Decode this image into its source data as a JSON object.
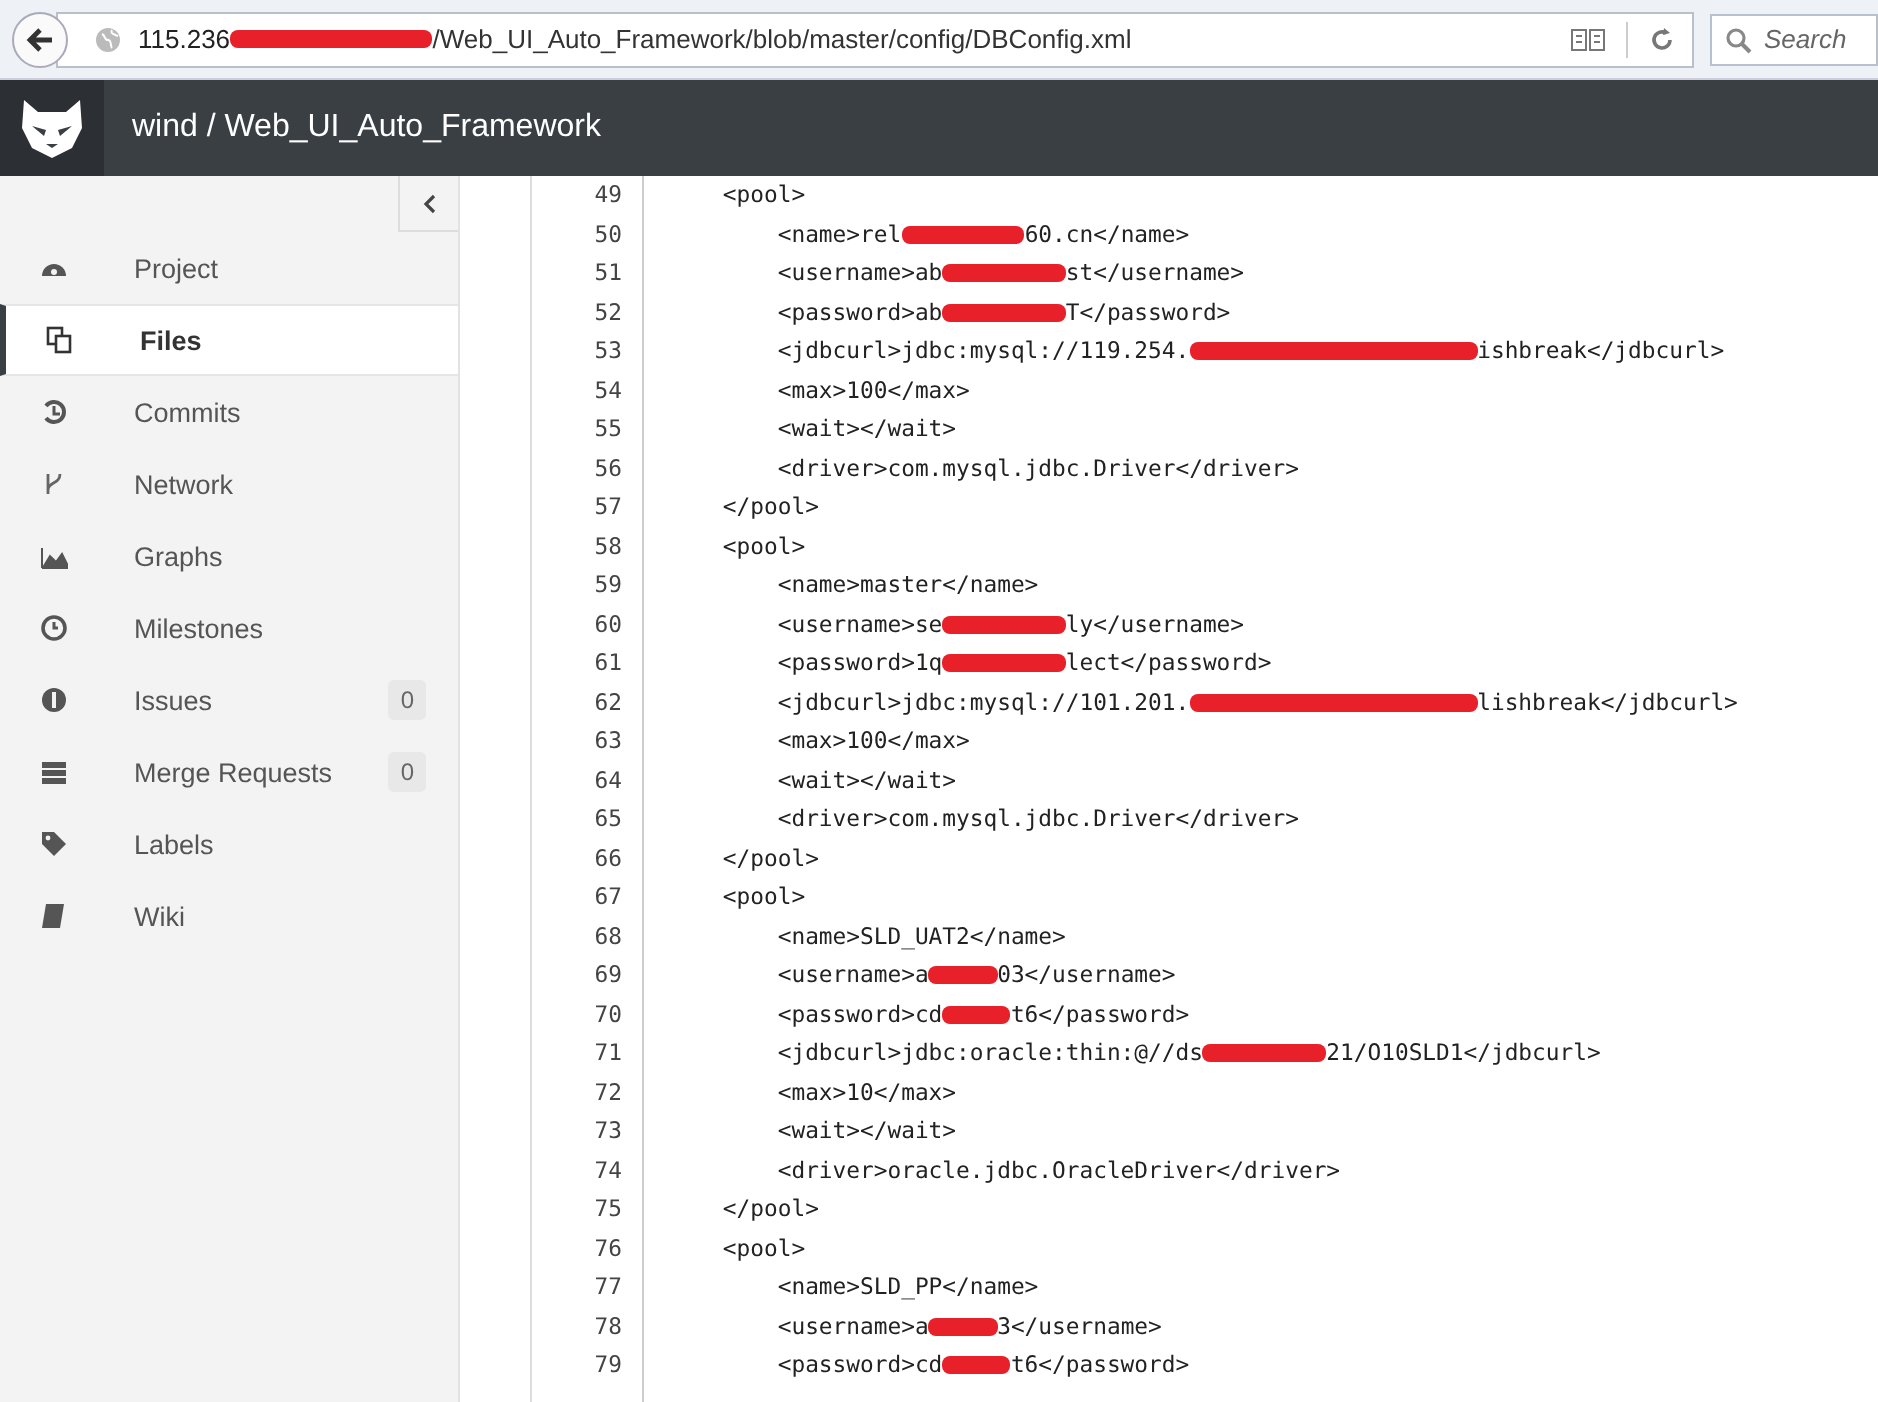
{
  "browser": {
    "url_parts": [
      {
        "kind": "text",
        "text": "115.236"
      },
      {
        "kind": "redaction"
      },
      {
        "kind": "text",
        "text": "/Web_UI_Auto_Framework/blob/master/config/DBConfig.xml"
      }
    ],
    "search": {
      "placeholder": "Search"
    }
  },
  "header": {
    "title": "wind / Web_UI_Auto_Framework"
  },
  "sidebar": {
    "items": [
      {
        "label": "Project",
        "selected": false
      },
      {
        "label": "Files",
        "selected": true
      },
      {
        "label": "Commits",
        "selected": false
      },
      {
        "label": "Network",
        "selected": false
      },
      {
        "label": "Graphs",
        "selected": false
      },
      {
        "label": "Milestones",
        "selected": false
      },
      {
        "label": "Issues",
        "selected": false,
        "count": "0"
      },
      {
        "label": "Merge Requests",
        "selected": false,
        "count": "0"
      },
      {
        "label": "Labels",
        "selected": false
      },
      {
        "label": "Wiki",
        "selected": false
      }
    ]
  },
  "file": {
    "lines": [
      {
        "number": "49",
        "parts": [
          {
            "kind": "text",
            "text": "    <pool>"
          }
        ]
      },
      {
        "number": "50",
        "parts": [
          {
            "kind": "text",
            "text": "        <name>rel"
          },
          {
            "kind": "redaction"
          },
          {
            "kind": "text",
            "text": "60.cn</name>"
          }
        ]
      },
      {
        "number": "51",
        "parts": [
          {
            "kind": "text",
            "text": "        <username>ab"
          },
          {
            "kind": "redaction"
          },
          {
            "kind": "text",
            "text": "st</username>"
          }
        ]
      },
      {
        "number": "52",
        "parts": [
          {
            "kind": "text",
            "text": "        <password>ab"
          },
          {
            "kind": "redaction"
          },
          {
            "kind": "text",
            "text": "T</password>"
          }
        ]
      },
      {
        "number": "53",
        "parts": [
          {
            "kind": "text",
            "text": "        <jdbcurl>jdbc:mysql://119.254."
          },
          {
            "kind": "long_redaction"
          },
          {
            "kind": "text",
            "text": "ishbreak</jdbcurl>"
          }
        ]
      },
      {
        "number": "54",
        "parts": [
          {
            "kind": "text",
            "text": "        <max>100</max>"
          }
        ]
      },
      {
        "number": "55",
        "parts": [
          {
            "kind": "text",
            "text": "        <wait></wait>"
          }
        ]
      },
      {
        "number": "56",
        "parts": [
          {
            "kind": "text",
            "text": "        <driver>com.mysql.jdbc.Driver</driver>"
          }
        ]
      },
      {
        "number": "57",
        "parts": [
          {
            "kind": "text",
            "text": "    </pool>"
          }
        ]
      },
      {
        "number": "58",
        "parts": [
          {
            "kind": "text",
            "text": "    <pool>"
          }
        ]
      },
      {
        "number": "59",
        "parts": [
          {
            "kind": "text",
            "text": "        <name>master</name>"
          }
        ]
      },
      {
        "number": "60",
        "parts": [
          {
            "kind": "text",
            "text": "        <username>se"
          },
          {
            "kind": "redaction"
          },
          {
            "kind": "text",
            "text": "ly</username>"
          }
        ]
      },
      {
        "number": "61",
        "parts": [
          {
            "kind": "text",
            "text": "        <password>1q"
          },
          {
            "kind": "redaction"
          },
          {
            "kind": "text",
            "text": "lect</password>"
          }
        ]
      },
      {
        "number": "62",
        "parts": [
          {
            "kind": "text",
            "text": "        <jdbcurl>jdbc:mysql://101.201."
          },
          {
            "kind": "long_redaction"
          },
          {
            "kind": "text",
            "text": "lishbreak</jdbcurl>"
          }
        ]
      },
      {
        "number": "63",
        "parts": [
          {
            "kind": "text",
            "text": "        <max>100</max>"
          }
        ]
      },
      {
        "number": "64",
        "parts": [
          {
            "kind": "text",
            "text": "        <wait></wait>"
          }
        ]
      },
      {
        "number": "65",
        "parts": [
          {
            "kind": "text",
            "text": "        <driver>com.mysql.jdbc.Driver</driver>"
          }
        ]
      },
      {
        "number": "66",
        "parts": [
          {
            "kind": "text",
            "text": "    </pool>"
          }
        ]
      },
      {
        "number": "67",
        "parts": [
          {
            "kind": "text",
            "text": "    <pool>"
          }
        ]
      },
      {
        "number": "68",
        "parts": [
          {
            "kind": "text",
            "text": "        <name>SLD_UAT2</name>"
          }
        ]
      },
      {
        "number": "69",
        "parts": [
          {
            "kind": "text",
            "text": "        <username>a"
          },
          {
            "kind": "short_redaction"
          },
          {
            "kind": "text",
            "text": "03</username>"
          }
        ]
      },
      {
        "number": "70",
        "parts": [
          {
            "kind": "text",
            "text": "        <password>cd"
          },
          {
            "kind": "short_redaction"
          },
          {
            "kind": "text",
            "text": "t6</password>"
          }
        ]
      },
      {
        "number": "71",
        "parts": [
          {
            "kind": "text",
            "text": "        <jdbcurl>jdbc:oracle:thin:@//ds"
          },
          {
            "kind": "redaction"
          },
          {
            "kind": "text",
            "text": "21/O10SLD1</jdbcurl>"
          }
        ]
      },
      {
        "number": "72",
        "parts": [
          {
            "kind": "text",
            "text": "        <max>10</max>"
          }
        ]
      },
      {
        "number": "73",
        "parts": [
          {
            "kind": "text",
            "text": "        <wait></wait>"
          }
        ]
      },
      {
        "number": "74",
        "parts": [
          {
            "kind": "text",
            "text": "        <driver>oracle.jdbc.OracleDriver</driver>"
          }
        ]
      },
      {
        "number": "75",
        "parts": [
          {
            "kind": "text",
            "text": "    </pool>"
          }
        ]
      },
      {
        "number": "76",
        "parts": [
          {
            "kind": "text",
            "text": "    <pool>"
          }
        ]
      },
      {
        "number": "77",
        "parts": [
          {
            "kind": "text",
            "text": "        <name>SLD_PP</name>"
          }
        ]
      },
      {
        "number": "78",
        "parts": [
          {
            "kind": "text",
            "text": "        <username>a"
          },
          {
            "kind": "short_redaction"
          },
          {
            "kind": "text",
            "text": "3</username>"
          }
        ]
      },
      {
        "number": "79",
        "parts": [
          {
            "kind": "text",
            "text": "        <password>cd"
          },
          {
            "kind": "short_redaction"
          },
          {
            "kind": "text",
            "text": "t6</password>"
          }
        ]
      }
    ]
  }
}
